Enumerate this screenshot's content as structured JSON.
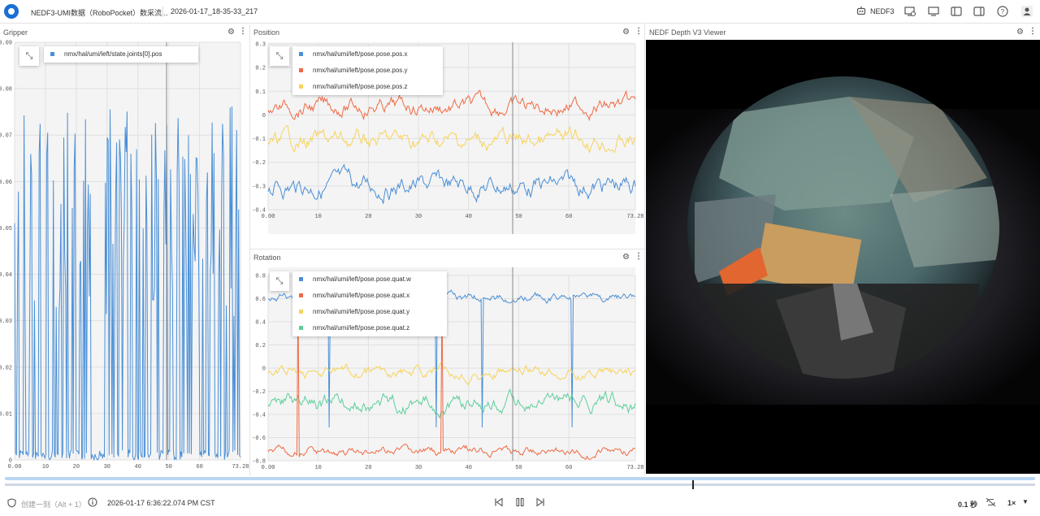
{
  "header": {
    "title": "NEDF3-UMI数据（RoboPocket）数采流...",
    "timestamp": "2026-01-17_18-35-33_217",
    "profile_label": "NEDF3"
  },
  "panels": {
    "gripper": {
      "title": "Gripper",
      "legend": [
        "nmx/hal/umi/left/state.joints[0].pos"
      ],
      "y_ticks": [
        "0.09",
        "0.08",
        "0.07",
        "0.06",
        "0.05",
        "0.04",
        "0.03",
        "0.02",
        "0.01",
        "0"
      ],
      "x_ticks": [
        "0.00",
        "10",
        "20",
        "30",
        "40",
        "50",
        "60",
        "73.28"
      ]
    },
    "position": {
      "title": "Position",
      "legend": [
        "nmx/hal/umi/left/pose.pose.pos.x",
        "nmx/hal/umi/left/pose.pose.pos.y",
        "nmx/hal/umi/left/pose.pose.pos.z"
      ],
      "y_ticks": [
        "0.3",
        "0.2",
        "0.1",
        "0",
        "-0.1",
        "-0.2",
        "-0.3",
        "-0.4"
      ],
      "x_ticks": [
        "0.00",
        "10",
        "20",
        "30",
        "40",
        "50",
        "60",
        "73.28"
      ]
    },
    "rotation": {
      "title": "Rotation",
      "legend": [
        "nmx/hal/umi/left/pose.pose.quat.w",
        "nmx/hal/umi/left/pose.pose.quat.x",
        "nmx/hal/umi/left/pose.pose.quat.y",
        "nmx/hal/umi/left/pose.pose.quat.z"
      ],
      "y_ticks": [
        "0.8",
        "0.6",
        "0.4",
        "0.2",
        "0",
        "-0.2",
        "-0.4",
        "-0.6",
        "-0.8"
      ],
      "x_ticks": [
        "0.00",
        "10",
        "20",
        "30",
        "40",
        "50",
        "60",
        "73.28"
      ]
    },
    "viewer": {
      "title": "NEDF Depth V3 Viewer"
    }
  },
  "footer": {
    "mark_label": "创建一刻（Alt + 1）",
    "current_time": "2026-01-17 6:36:22.074 PM CST",
    "step_label": "0.1 秒",
    "speed_label": "1×"
  },
  "colors": {
    "blue": "#4a8fd6",
    "red": "#ef6a45",
    "yellow": "#f7d35c",
    "green": "#5ccf9a"
  },
  "icons": [
    "logo-icon",
    "robot-icon",
    "monitor-add-icon",
    "monitor-icon",
    "layout-left-icon",
    "layout-right-icon",
    "help-icon",
    "user-icon",
    "settings-icon",
    "more-icon",
    "collapse-icon",
    "shield-icon",
    "info-icon",
    "skip-back-icon",
    "pause-icon",
    "skip-forward-icon",
    "loop-icon",
    "dropdown-icon"
  ]
}
